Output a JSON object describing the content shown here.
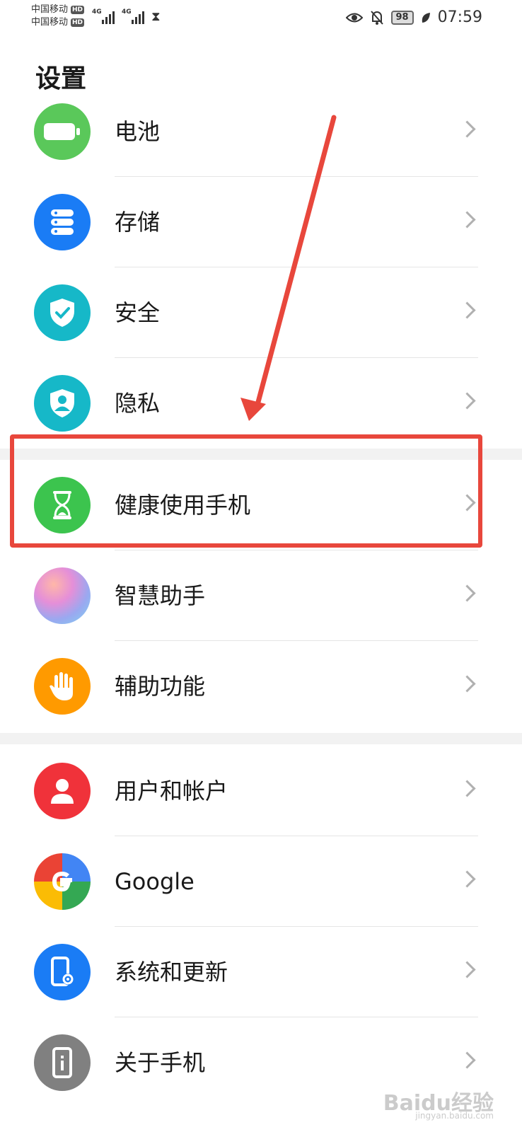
{
  "status_bar": {
    "carrier_1": "中国移动",
    "carrier_2": "中国移动",
    "hd_badge": "HD",
    "network_1": "4G",
    "network_2": "4G",
    "battery": "98",
    "time": "07:59"
  },
  "page_title": "设置",
  "items": [
    {
      "label": "电池",
      "icon": "battery-icon",
      "color": "#5ac85a"
    },
    {
      "label": "存储",
      "icon": "storage-icon",
      "color": "#1a7cf5"
    },
    {
      "label": "安全",
      "icon": "shield-check-icon",
      "color": "#16b8c8"
    },
    {
      "label": "隐私",
      "icon": "privacy-shield-icon",
      "color": "#16b8c8"
    },
    {
      "label": "健康使用手机",
      "icon": "hourglass-icon",
      "color": "#3cc44e"
    },
    {
      "label": "智慧助手",
      "icon": "assistant-icon",
      "color": "#b79de6"
    },
    {
      "label": "辅助功能",
      "icon": "hand-icon",
      "color": "#ff9a00"
    },
    {
      "label": "用户和帐户",
      "icon": "user-icon",
      "color": "#f0323a"
    },
    {
      "label": "Google",
      "icon": "google-icon",
      "color": "#4285f4"
    },
    {
      "label": "系统和更新",
      "icon": "phone-gear-icon",
      "color": "#1a7cf5"
    },
    {
      "label": "关于手机",
      "icon": "phone-info-icon",
      "color": "#808080"
    }
  ],
  "annotation": {
    "color": "#e8473c"
  },
  "watermark": {
    "text": "Baidu经验",
    "sub": "jingyan.baidu.com"
  }
}
